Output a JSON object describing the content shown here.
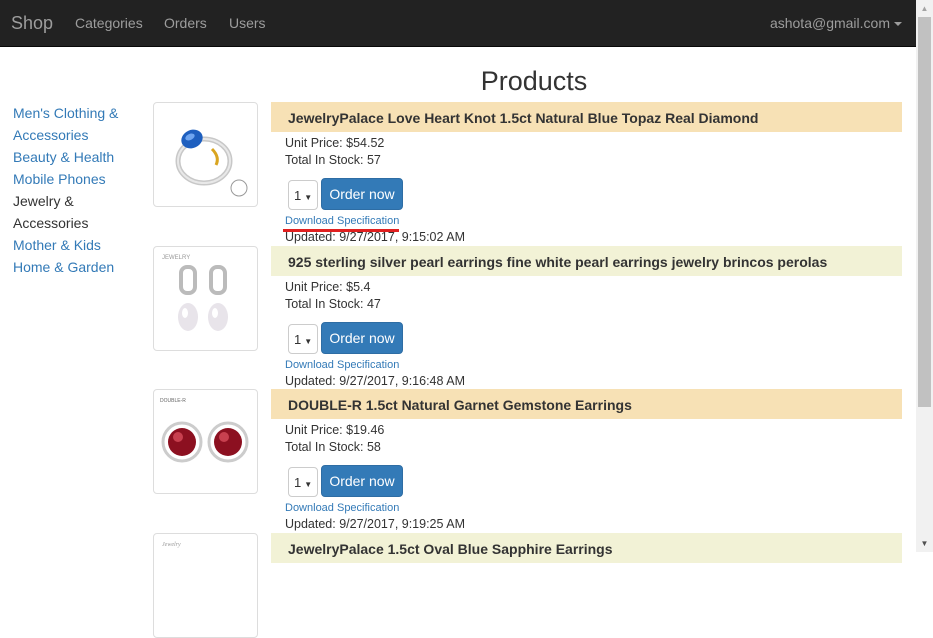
{
  "navbar": {
    "brand": "Shop",
    "links": [
      "Categories",
      "Orders",
      "Users"
    ],
    "user": "ashota@gmail.com"
  },
  "sidebar": {
    "categories": [
      {
        "label": "Men's Clothing & Accessories",
        "active": false
      },
      {
        "label": "Beauty & Health",
        "active": false
      },
      {
        "label": "Mobile Phones",
        "active": false
      },
      {
        "label": "Jewelry & Accessories",
        "active": true
      },
      {
        "label": "Mother & Kids",
        "active": false
      },
      {
        "label": "Home & Garden",
        "active": false
      }
    ]
  },
  "main": {
    "title": "Products",
    "download_label": "Download Specification",
    "order_label": "Order now",
    "products": [
      {
        "name": "JewelryPalace Love Heart Knot 1.5ct Natural Blue Topaz Real Diamond",
        "price": "Unit Price: $54.52",
        "stock": "Total In Stock: 57",
        "qty": "1",
        "updated": "Updated: 9/27/2017, 9:15:02 AM",
        "header_color": "#f7e1b5"
      },
      {
        "name": "925 sterling silver pearl earrings fine white pearl earrings jewelry brincos perolas",
        "price": "Unit Price: $5.4",
        "stock": "Total In Stock: 47",
        "qty": "1",
        "updated": "Updated: 9/27/2017, 9:16:48 AM",
        "header_color": "#f2f2d6"
      },
      {
        "name": "DOUBLE-R 1.5ct Natural Garnet Gemstone Earrings",
        "price": "Unit Price: $19.46",
        "stock": "Total In Stock: 58",
        "qty": "1",
        "updated": "Updated: 9/27/2017, 9:19:25 AM",
        "header_color": "#f7e1b5"
      },
      {
        "name": "JewelryPalace 1.5ct Oval Blue Sapphire Earrings",
        "header_color": "#f2f2d6"
      }
    ]
  }
}
